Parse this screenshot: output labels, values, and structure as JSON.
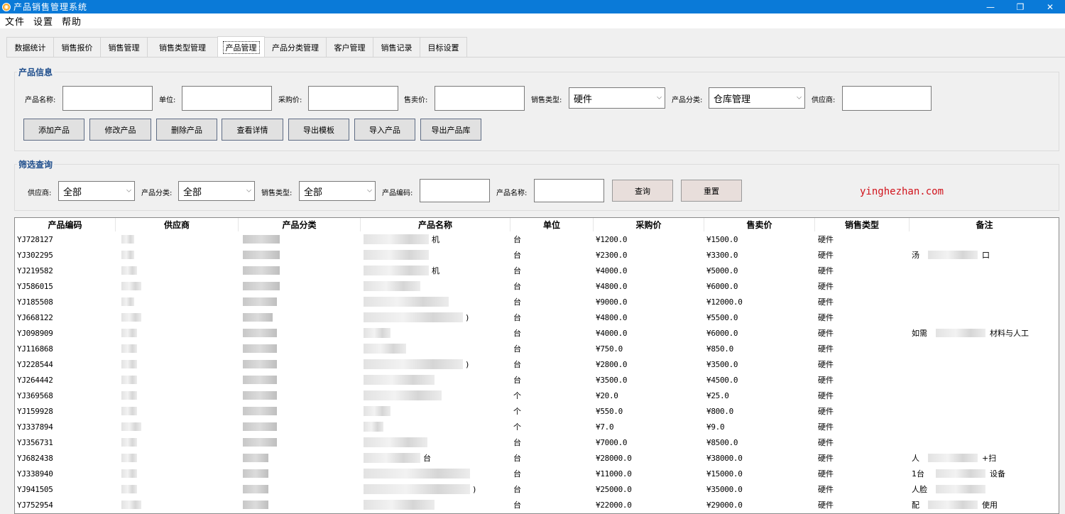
{
  "window": {
    "title": "产品销售管理系统",
    "min": "—",
    "max": "❐",
    "close": "✕"
  },
  "menu": [
    "文件",
    "设置",
    "帮助"
  ],
  "tabs": [
    "数据统计",
    "销售报价",
    "销售管理",
    "销售类型管理",
    "产品管理",
    "产品分类管理",
    "客户管理",
    "销售记录",
    "目标设置"
  ],
  "active_tab": "产品管理",
  "product_info": {
    "title": "产品信息",
    "labels": {
      "name": "产品名称:",
      "unit": "单位:",
      "purchase_price": "采购价:",
      "sale_price": "售卖价:",
      "sale_type": "销售类型:",
      "category": "产品分类:",
      "supplier": "供应商:"
    },
    "sale_type_value": "硬件",
    "category_value": "仓库管理",
    "buttons": [
      "添加产品",
      "修改产品",
      "删除产品",
      "查看详情",
      "导出模板",
      "导入产品",
      "导出产品库"
    ]
  },
  "filter": {
    "title": "筛选查询",
    "labels": {
      "supplier": "供应商:",
      "category": "产品分类:",
      "sale_type": "销售类型:",
      "code": "产品编码:",
      "name": "产品名称:"
    },
    "supplier_value": "全部",
    "category_value": "全部",
    "sale_type_value": "全部",
    "query_button": "查询",
    "reset_button": "重置"
  },
  "watermark": "yinghezhan.com",
  "table": {
    "columns": [
      "产品编码",
      "供应商",
      "产品分类",
      "产品名称",
      "单位",
      "采购价",
      "售卖价",
      "销售类型",
      "备注"
    ],
    "rows": [
      {
        "code": "YJ728127",
        "name_suffix": "机",
        "unit": "台",
        "purchase": "¥1200.0",
        "sale": "¥1500.0",
        "type": "硬件",
        "note": ""
      },
      {
        "code": "YJ302295",
        "name_suffix": "",
        "unit": "台",
        "purchase": "¥2300.0",
        "sale": "¥3300.0",
        "type": "硬件",
        "note": "汤",
        "note_suffix": "口"
      },
      {
        "code": "YJ219582",
        "name_suffix": "机",
        "unit": "台",
        "purchase": "¥4000.0",
        "sale": "¥5000.0",
        "type": "硬件",
        "note": ""
      },
      {
        "code": "YJ586015",
        "name_suffix": "",
        "unit": "台",
        "purchase": "¥4800.0",
        "sale": "¥6000.0",
        "type": "硬件",
        "note": ""
      },
      {
        "code": "YJ185508",
        "name_suffix": "",
        "unit": "台",
        "purchase": "¥9000.0",
        "sale": "¥12000.0",
        "type": "硬件",
        "note": ""
      },
      {
        "code": "YJ668122",
        "name_suffix": ")",
        "unit": "台",
        "purchase": "¥4800.0",
        "sale": "¥5500.0",
        "type": "硬件",
        "note": ""
      },
      {
        "code": "YJ098909",
        "name_suffix": "",
        "unit": "台",
        "purchase": "¥4000.0",
        "sale": "¥6000.0",
        "type": "硬件",
        "note": "如需",
        "note_suffix": "材料与人工"
      },
      {
        "code": "YJ116868",
        "name_suffix": "",
        "unit": "台",
        "purchase": "¥750.0",
        "sale": "¥850.0",
        "type": "硬件",
        "note": ""
      },
      {
        "code": "YJ228544",
        "name_suffix": ")",
        "unit": "台",
        "purchase": "¥2800.0",
        "sale": "¥3500.0",
        "type": "硬件",
        "note": ""
      },
      {
        "code": "YJ264442",
        "name_suffix": "",
        "unit": "台",
        "purchase": "¥3500.0",
        "sale": "¥4500.0",
        "type": "硬件",
        "note": ""
      },
      {
        "code": "YJ369568",
        "name_suffix": "",
        "unit": "个",
        "purchase": "¥20.0",
        "sale": "¥25.0",
        "type": "硬件",
        "note": ""
      },
      {
        "code": "YJ159928",
        "name_suffix": "",
        "unit": "个",
        "purchase": "¥550.0",
        "sale": "¥800.0",
        "type": "硬件",
        "note": ""
      },
      {
        "code": "YJ337894",
        "name_suffix": "",
        "unit": "个",
        "purchase": "¥7.0",
        "sale": "¥9.0",
        "type": "硬件",
        "note": ""
      },
      {
        "code": "YJ356731",
        "name_suffix": "",
        "unit": "台",
        "purchase": "¥7000.0",
        "sale": "¥8500.0",
        "type": "硬件",
        "note": ""
      },
      {
        "code": "YJ682438",
        "name_suffix": "台",
        "unit": "台",
        "purchase": "¥28000.0",
        "sale": "¥38000.0",
        "type": "硬件",
        "note": "人",
        "note_suffix": "+扫"
      },
      {
        "code": "YJ338940",
        "name_suffix": "",
        "unit": "台",
        "purchase": "¥11000.0",
        "sale": "¥15000.0",
        "type": "硬件",
        "note": "1台",
        "note_suffix": "设备"
      },
      {
        "code": "YJ941505",
        "name_suffix": ")",
        "unit": "台",
        "purchase": "¥25000.0",
        "sale": "¥35000.0",
        "type": "硬件",
        "note": "人脸",
        "note_suffix": ""
      },
      {
        "code": "YJ752954",
        "name_suffix": "",
        "unit": "台",
        "purchase": "¥22000.0",
        "sale": "¥29000.0",
        "type": "硬件",
        "note": "配",
        "note_suffix": "使用"
      }
    ]
  }
}
